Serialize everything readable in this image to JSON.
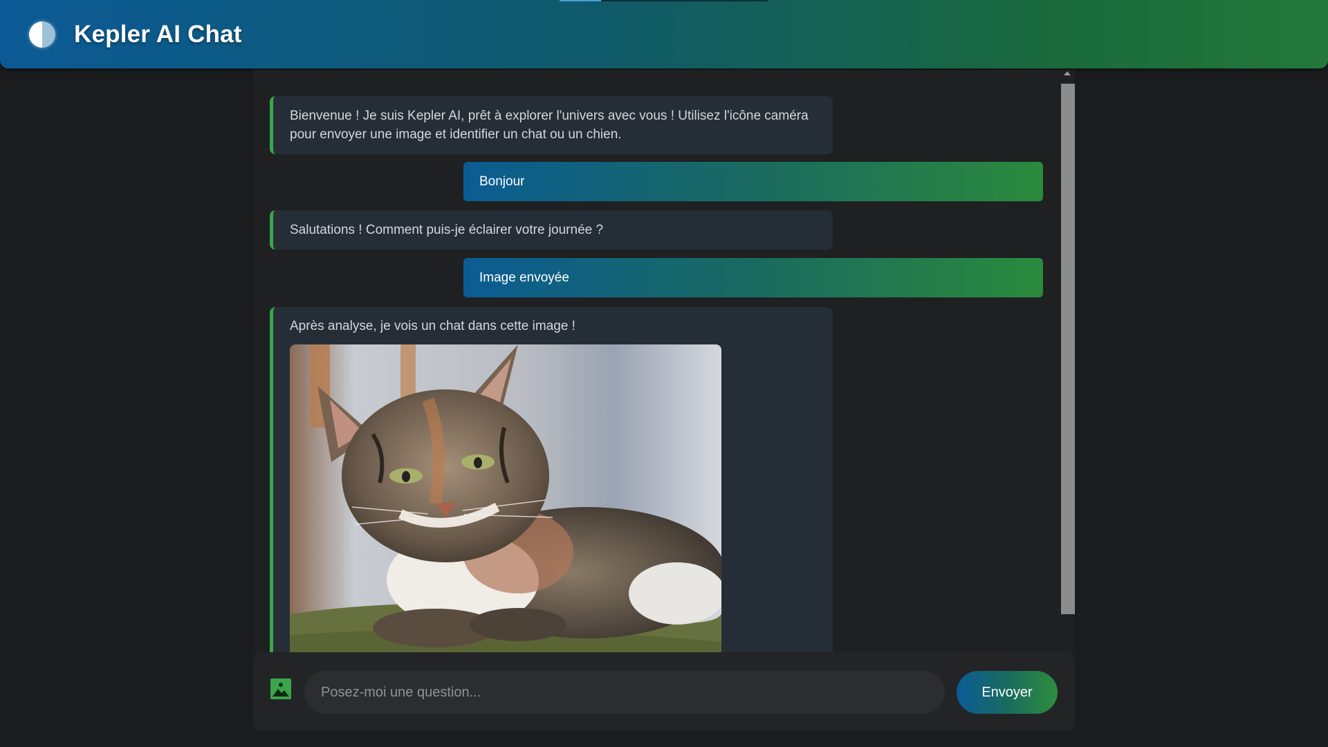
{
  "header": {
    "title": "Kepler AI Chat",
    "logo_icon": "half-moon-icon"
  },
  "messages": [
    {
      "role": "bot",
      "text": "Bienvenue ! Je suis Kepler AI, prêt à explorer l'univers avec vous ! Utilisez l'icône caméra pour envoyer une image et identifier un chat ou un chien."
    },
    {
      "role": "user",
      "text": "Bonjour"
    },
    {
      "role": "bot",
      "text": "Salutations ! Comment puis-je éclairer votre journée ?"
    },
    {
      "role": "user",
      "text": "Image envoyée"
    },
    {
      "role": "bot",
      "text": "Après analyse, je vois un chat dans cette image !",
      "has_image": true
    }
  ],
  "input": {
    "placeholder": "Posez-moi une question...",
    "value": "",
    "image_button_icon": "image-upload-icon"
  },
  "send_button": {
    "label": "Envoyer"
  },
  "colors": {
    "header_start": "#0b5a96",
    "header_end": "#22783a",
    "bot_accent": "#3aa64a",
    "bot_bg": "#252e36",
    "page_bg": "#1b1c1e"
  }
}
